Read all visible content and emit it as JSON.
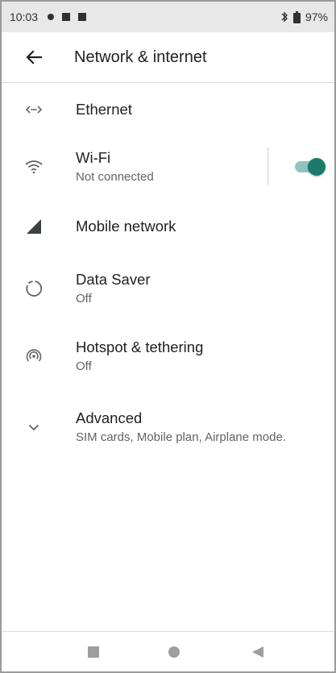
{
  "status_bar": {
    "time": "10:03",
    "battery": "97%"
  },
  "header": {
    "title": "Network & internet"
  },
  "items": [
    {
      "id": "ethernet",
      "title": "Ethernet",
      "icon": "ethernet-icon"
    },
    {
      "id": "wifi",
      "title": "Wi-Fi",
      "subtitle": "Not connected",
      "icon": "wifi-icon",
      "toggle_on": true
    },
    {
      "id": "mobile",
      "title": "Mobile network",
      "icon": "signal-icon"
    },
    {
      "id": "datasaver",
      "title": "Data Saver",
      "subtitle": "Off",
      "icon": "data-saver-icon"
    },
    {
      "id": "hotspot",
      "title": "Hotspot & tethering",
      "subtitle": "Off",
      "icon": "hotspot-icon"
    },
    {
      "id": "advanced",
      "title": "Advanced",
      "subtitle": "SIM cards, Mobile plan, Airplane mode.",
      "icon": "chevron-down-icon"
    }
  ],
  "colors": {
    "accent": "#1b7a6a",
    "accent_track": "#8fc5bd",
    "status_bar_bg": "#e8e8e8"
  }
}
